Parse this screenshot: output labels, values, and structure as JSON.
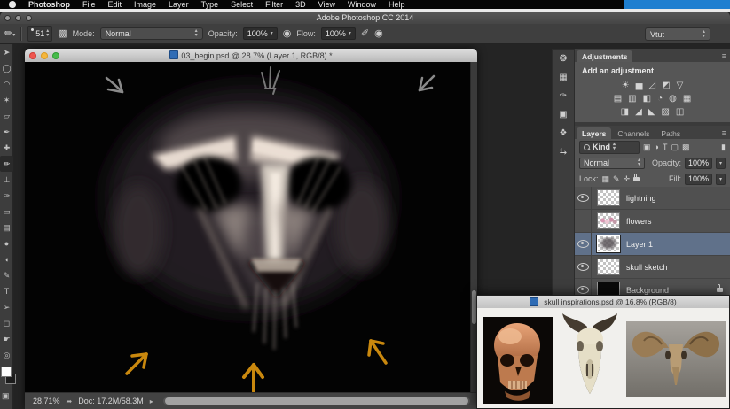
{
  "menu_bar": {
    "items": [
      "Photoshop",
      "File",
      "Edit",
      "Image",
      "Layer",
      "Type",
      "Select",
      "Filter",
      "3D",
      "View",
      "Window",
      "Help"
    ]
  },
  "title_bar": {
    "title": "Adobe Photoshop CC 2014"
  },
  "options_bar": {
    "brush_size": "51",
    "mode_label": "Mode:",
    "mode_value": "Normal",
    "opacity_label": "Opacity:",
    "opacity_value": "100%",
    "flow_label": "Flow:",
    "flow_value": "100%",
    "workspace": "Vtut"
  },
  "toolbar": {
    "tools": [
      {
        "name": "move",
        "glyph": "➤"
      },
      {
        "name": "marquee",
        "glyph": "◯"
      },
      {
        "name": "lasso",
        "glyph": "◠"
      },
      {
        "name": "quick-selection",
        "glyph": "✶"
      },
      {
        "name": "crop",
        "glyph": "▱"
      },
      {
        "name": "eyedropper",
        "glyph": "✒"
      },
      {
        "name": "healing-brush",
        "glyph": "✚"
      },
      {
        "name": "brush",
        "glyph": "✏",
        "selected": true
      },
      {
        "name": "clone-stamp",
        "glyph": "⊥"
      },
      {
        "name": "history-brush",
        "glyph": "✑"
      },
      {
        "name": "eraser",
        "glyph": "▭"
      },
      {
        "name": "gradient",
        "glyph": "▤"
      },
      {
        "name": "blur",
        "glyph": "●"
      },
      {
        "name": "dodge",
        "glyph": "◖"
      },
      {
        "name": "pen",
        "glyph": "✎"
      },
      {
        "name": "type",
        "glyph": "T"
      },
      {
        "name": "path-selection",
        "glyph": "➢"
      },
      {
        "name": "shape",
        "glyph": "◻"
      },
      {
        "name": "hand",
        "glyph": "☛"
      },
      {
        "name": "zoom",
        "glyph": "◎"
      }
    ]
  },
  "document_window": {
    "title": "03_begin.psd @ 28.7% (Layer 1, RGB/8) *",
    "status_zoom": "28.71%",
    "status_doc": "Doc: 17.2M/58.3M"
  },
  "panel_dock": {
    "icons": [
      {
        "name": "color-panel-icon",
        "glyph": "❂"
      },
      {
        "name": "swatches-panel-icon",
        "glyph": "▦"
      },
      {
        "name": "brush-presets-panel-icon",
        "glyph": "✑"
      },
      {
        "name": "clone-source-panel-icon",
        "glyph": "▣"
      },
      {
        "name": "styles-panel-icon",
        "glyph": "❖"
      },
      {
        "name": "history-panel-icon",
        "glyph": "⇆"
      }
    ]
  },
  "adjustments_panel": {
    "tab": "Adjustments",
    "heading": "Add an adjustment",
    "row1": [
      "☀",
      "▅",
      "◿",
      "◩",
      "▽"
    ],
    "row2": [
      "▤",
      "▥",
      "◧",
      "◔",
      "◍",
      "▦"
    ],
    "row3": [
      "◨",
      "◢",
      "◣",
      "▧",
      "◫"
    ]
  },
  "layers_panel": {
    "tabs": [
      "Layers",
      "Channels",
      "Paths"
    ],
    "filter_value": "Kind",
    "filter_icons": [
      "▣",
      "◑",
      "T",
      "▢",
      "▩"
    ],
    "blend_mode": "Normal",
    "opacity_label": "Opacity:",
    "opacity_value": "100%",
    "lock_label": "Lock:",
    "lock_icons": [
      "▦",
      "✎",
      "✛"
    ],
    "fill_label": "Fill:",
    "fill_value": "100%",
    "layers": [
      {
        "name": "lightning",
        "visible": true,
        "thumb": "transparent"
      },
      {
        "name": "flowers",
        "visible": false,
        "thumb": "flowers"
      },
      {
        "name": "Layer 1",
        "visible": true,
        "selected": true,
        "thumb": "sketch"
      },
      {
        "name": "skull sketch",
        "visible": true,
        "thumb": "transparent"
      },
      {
        "name": "Background",
        "visible": true,
        "locked": true,
        "thumb": "black"
      }
    ]
  },
  "inspirations_window": {
    "title": "skull inspirations.psd @ 16.8% (RGB/8)"
  },
  "colors": {
    "selected_layer": "#60718a",
    "menu_strip_blue": "#1f7fd0",
    "arrow_orange": "#c9880e",
    "canvas_black": "#030303"
  }
}
